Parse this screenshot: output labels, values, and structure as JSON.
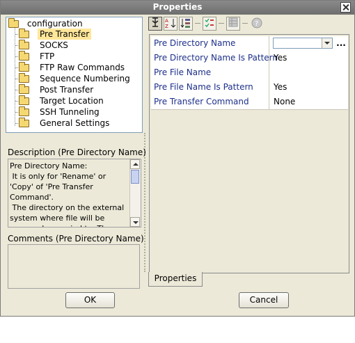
{
  "window": {
    "title": "Properties"
  },
  "tree": {
    "root": "configuration",
    "items": [
      {
        "label": "Pre Transfer",
        "selected": true
      },
      {
        "label": "SOCKS"
      },
      {
        "label": "FTP"
      },
      {
        "label": "FTP Raw Commands"
      },
      {
        "label": "Sequence Numbering"
      },
      {
        "label": "Post Transfer"
      },
      {
        "label": "Target Location"
      },
      {
        "label": "SSH Tunneling"
      },
      {
        "label": "General Settings"
      }
    ]
  },
  "description": {
    "heading": "Description (Pre Directory Name)",
    "text": "Pre Directory Name:\n It is only for 'Rename' or 'Copy' of 'Pre Transfer Command'.\n The directory on the external system where file will be renamed or copied to. The directory"
  },
  "comments": {
    "heading": "Comments (Pre Directory Name)",
    "text": ""
  },
  "toolbar": {
    "icons": [
      "categorized-icon",
      "sort-alpha-icon",
      "sort-props-icon",
      "check-list-icon",
      "grid-icon",
      "help-icon"
    ]
  },
  "properties": {
    "rows": [
      {
        "name": "Pre Directory Name",
        "value": "",
        "editor": "combo",
        "more": "..."
      },
      {
        "name": "Pre Directory Name Is Pattern",
        "value": "Yes"
      },
      {
        "name": "Pre File Name",
        "value": ""
      },
      {
        "name": "Pre File Name Is Pattern",
        "value": "Yes"
      },
      {
        "name": "Pre Transfer Command",
        "value": "None"
      }
    ],
    "tab_label": "Properties"
  },
  "buttons": {
    "ok": "OK",
    "cancel": "Cancel"
  },
  "colors": {
    "property_name": "#1d2f8a",
    "selection": "#ffe79a",
    "dialog_bg": "#ece9d8"
  }
}
